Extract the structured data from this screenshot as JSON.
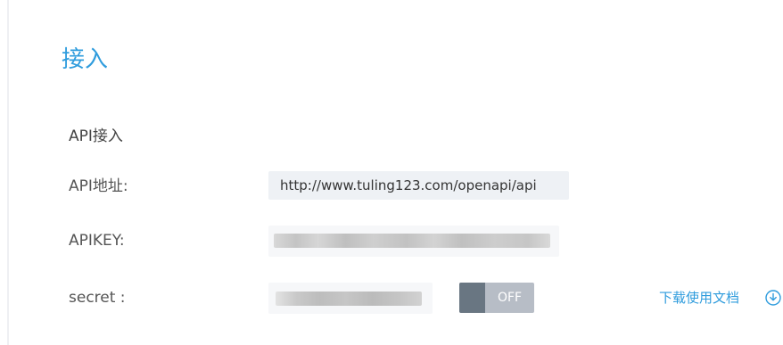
{
  "section": {
    "title": "接入",
    "subtitle": "API接入"
  },
  "fields": {
    "api_address_label": "API地址:",
    "api_address_value": "http://www.tuling123.com/openapi/api",
    "apikey_label": "APIKEY:",
    "secret_label": "secret :"
  },
  "toggle": {
    "label": "OFF",
    "state": "off"
  },
  "download": {
    "label": "下载使用文档",
    "icon": "download-circle-icon"
  },
  "colors": {
    "accent": "#2f9cdd",
    "toggle_track": "#b7bdc6",
    "toggle_knob": "#697682",
    "field_bg": "#eef1f5"
  }
}
